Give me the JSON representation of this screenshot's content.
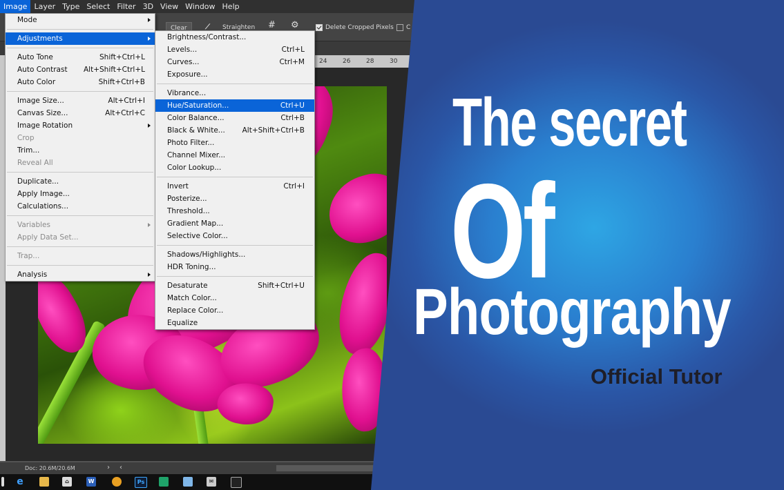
{
  "menubar": [
    "Image",
    "Layer",
    "Type",
    "Select",
    "Filter",
    "3D",
    "View",
    "Window",
    "Help"
  ],
  "options": {
    "clear": "Clear",
    "straighten": "Straighten",
    "delete_cropped": "Delete Cropped Pixels",
    "content_aware_partial": "C"
  },
  "ruler_ticks": [
    "24",
    "26",
    "28",
    "30"
  ],
  "image_menu": {
    "mode": "Mode",
    "adjustments": "Adjustments",
    "auto_tone": {
      "label": "Auto Tone",
      "shortcut": "Shift+Ctrl+L"
    },
    "auto_contrast": {
      "label": "Auto Contrast",
      "shortcut": "Alt+Shift+Ctrl+L"
    },
    "auto_color": {
      "label": "Auto Color",
      "shortcut": "Shift+Ctrl+B"
    },
    "image_size": {
      "label": "Image Size...",
      "shortcut": "Alt+Ctrl+I"
    },
    "canvas_size": {
      "label": "Canvas Size...",
      "shortcut": "Alt+Ctrl+C"
    },
    "image_rotation": "Image Rotation",
    "crop": "Crop",
    "trim": "Trim...",
    "reveal_all": "Reveal All",
    "duplicate": "Duplicate...",
    "apply_image": "Apply Image...",
    "calculations": "Calculations...",
    "variables": "Variables",
    "apply_data_set": "Apply Data Set...",
    "trap": "Trap...",
    "analysis": "Analysis"
  },
  "adjustments_menu": {
    "brightness_contrast": "Brightness/Contrast...",
    "levels": {
      "label": "Levels...",
      "shortcut": "Ctrl+L"
    },
    "curves": {
      "label": "Curves...",
      "shortcut": "Ctrl+M"
    },
    "exposure": "Exposure...",
    "vibrance": "Vibrance...",
    "hue_saturation": {
      "label": "Hue/Saturation...",
      "shortcut": "Ctrl+U"
    },
    "color_balance": {
      "label": "Color Balance...",
      "shortcut": "Ctrl+B"
    },
    "black_white": {
      "label": "Black & White...",
      "shortcut": "Alt+Shift+Ctrl+B"
    },
    "photo_filter": "Photo Filter...",
    "channel_mixer": "Channel Mixer...",
    "color_lookup": "Color Lookup...",
    "invert": {
      "label": "Invert",
      "shortcut": "Ctrl+I"
    },
    "posterize": "Posterize...",
    "threshold": "Threshold...",
    "gradient_map": "Gradient Map...",
    "selective_color": "Selective Color...",
    "shadows_highlights": "Shadows/Highlights...",
    "hdr_toning": "HDR Toning...",
    "desaturate": {
      "label": "Desaturate",
      "shortcut": "Shift+Ctrl+U"
    },
    "match_color": "Match Color...",
    "replace_color": "Replace Color...",
    "equalize": "Equalize"
  },
  "status": {
    "doc": "Doc: 20.6M/20.6M"
  },
  "taskbar": {
    "ps_label": "Ps",
    "word_label": "W"
  },
  "promo": {
    "line1": "The secret",
    "line2": "Of",
    "line3": "Photography",
    "line4": "Official Tutor"
  },
  "colors": {
    "highlight": "#0a64d8",
    "promo_blue": "#2a7fcf",
    "petal": "#e0108f",
    "foliage": "#6fb014"
  }
}
